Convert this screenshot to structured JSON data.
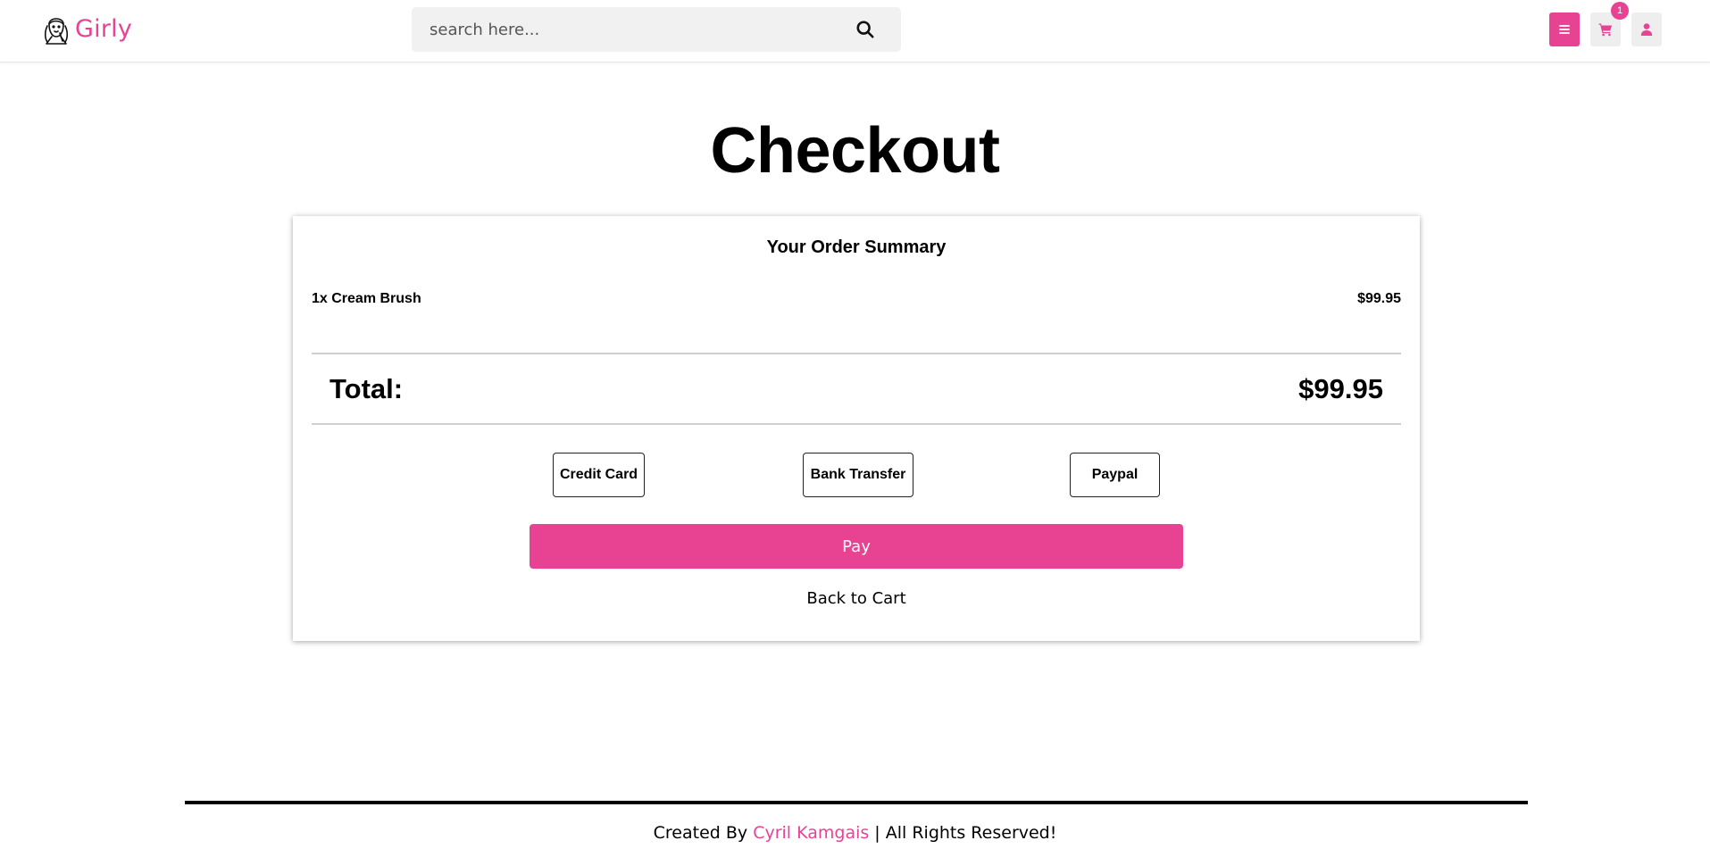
{
  "header": {
    "logo_text": "Girly",
    "logo_icon": "girl-face-icon",
    "search": {
      "placeholder": "search here...",
      "value": "",
      "icon": "search-icon"
    },
    "menu_icon": "hamburger-menu-icon",
    "cart_icon": "shopping-cart-icon",
    "cart_count": "1",
    "user_icon": "user-icon"
  },
  "main": {
    "title": "Checkout",
    "order_summary": {
      "heading": "Your Order Summary",
      "items": [
        {
          "label": "1x Cream Brush",
          "price": "$99.95"
        }
      ],
      "total_label": "Total:",
      "total_value": "$99.95"
    },
    "payment_options": [
      {
        "label": "Credit Card"
      },
      {
        "label": "Bank Transfer"
      },
      {
        "label": "Paypal"
      }
    ],
    "pay_label": "Pay",
    "back_label": "Back to Cart"
  },
  "footer": {
    "prefix": "Created By ",
    "author": "Cyril Kamgais",
    "suffix": " | All Rights Reserved!"
  },
  "colors": {
    "accent": "#e84393",
    "icon_bg": "#eeeeee",
    "search_bg": "#f1f1f1"
  }
}
